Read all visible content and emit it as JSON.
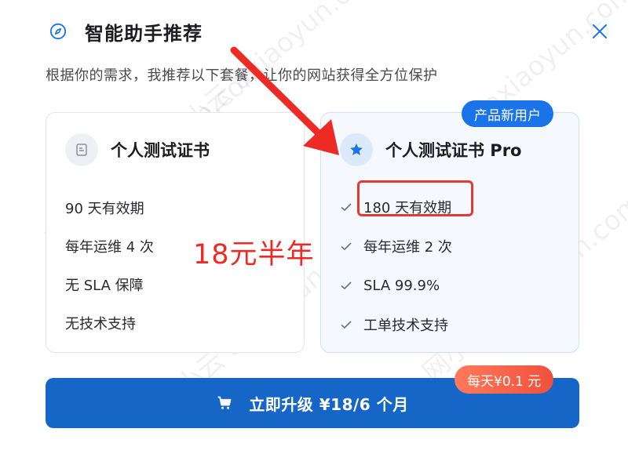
{
  "header": {
    "title": "智能助手推荐",
    "icon": "compass-icon"
  },
  "subtitle": "根据你的需求，我推荐以下套餐，让你的网站获得全方位保护",
  "close_icon": "close-icon",
  "plans": [
    {
      "name": "个人测试证书",
      "icon": "certificate-icon",
      "features": [
        "90 天有效期",
        "每年运维 4 次",
        "无 SLA 保障",
        "无技术支持"
      ]
    },
    {
      "name": "个人测试证书 Pro",
      "icon": "star-icon",
      "badge": "产品新用户",
      "features": [
        "180 天有效期",
        "每年运维 2 次",
        "SLA 99.9%",
        "工单技术支持"
      ]
    }
  ],
  "annotation": {
    "promo_text": "18元半年",
    "arrow_color": "#ee2a24"
  },
  "cta": {
    "label": "立即升级 ¥18/6 个月",
    "icon": "cart-icon",
    "badge": "每天¥0.1 元"
  },
  "watermark": {
    "text": "网小云 axiaoyun.com"
  },
  "colors": {
    "primary": "#1566c6",
    "badge_blue": "#1a73e8",
    "annotation_red": "#ee2a24",
    "daily_badge": "#f0503c"
  }
}
